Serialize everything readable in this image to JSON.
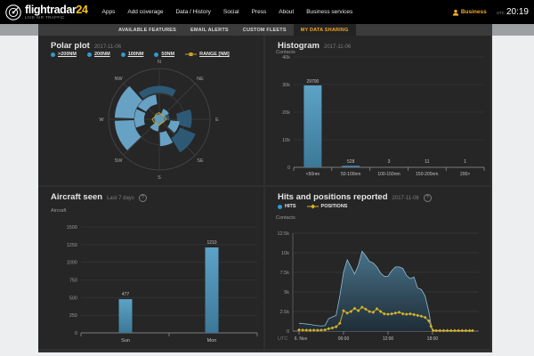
{
  "header": {
    "logo": {
      "name": "flightradar",
      "accent": "24",
      "tagline": "LIVE AIR TRAFFIC"
    },
    "nav": [
      "Apps",
      "Add coverage",
      "Data / History",
      "Social",
      "Press",
      "About",
      "Business services"
    ],
    "account_label": "Business",
    "utc_label": "UTC",
    "clock": "20:19"
  },
  "subnav": {
    "items": [
      {
        "label": "AVAILABLE FEATURES",
        "active": false
      },
      {
        "label": "EMAIL ALERTS",
        "active": false
      },
      {
        "label": "CUSTOM FLEETS",
        "active": false
      },
      {
        "label": "MY DATA SHARING",
        "active": true
      }
    ]
  },
  "chart_data": {
    "polar": {
      "type": "polar",
      "title": "Polar plot",
      "date": "2017-11-06",
      "legend": [
        ">200NM",
        "200NM",
        "100NM",
        "50NM"
      ],
      "range_series": "RANGE [NM]",
      "compass": [
        "N",
        "NE",
        "E",
        "SE",
        "S",
        "SW",
        "W",
        "NW"
      ],
      "colors": {
        "light": "#6cacd1",
        "dark": "#2f5d7c",
        "range": "#c9a227",
        "dot": "#2f9ad0"
      },
      "sectors": [
        {
          "from": -38,
          "to": 30,
          "inner": 0.52,
          "outer": 0.66,
          "shade": "dark"
        },
        {
          "from": 300,
          "to": 352,
          "inner": 0.3,
          "outer": 0.49,
          "shade": "light"
        },
        {
          "from": 250,
          "to": 294,
          "inner": 0.3,
          "outer": 0.49,
          "shade": "light"
        },
        {
          "from": 272,
          "to": 318,
          "inner": 0.5,
          "outer": 0.88,
          "shade": "light"
        },
        {
          "from": 226,
          "to": 268,
          "inner": 0.5,
          "outer": 0.88,
          "shade": "light"
        },
        {
          "from": 72,
          "to": 106,
          "inner": 0.35,
          "outer": 0.64,
          "shade": "dark"
        },
        {
          "from": 112,
          "to": 148,
          "inner": 0.44,
          "outer": 0.77,
          "shade": "dark"
        },
        {
          "from": 150,
          "to": 178,
          "inner": 0.26,
          "outer": 0.53,
          "shade": "light"
        },
        {
          "from": 96,
          "to": 132,
          "inner": 0.22,
          "outer": 0.4,
          "shade": "light"
        },
        {
          "from": 20,
          "to": 60,
          "inner": 0.1,
          "outer": 0.22,
          "shade": "light"
        },
        {
          "from": 185,
          "to": 230,
          "inner": 0.1,
          "outer": 0.24,
          "shade": "light"
        },
        {
          "from": 58,
          "to": 96,
          "inner": 0.1,
          "outer": 0.2,
          "shade": "dark"
        }
      ],
      "center_blob_r": 0.1,
      "range_polygon": [
        [
          0,
          0.13
        ],
        [
          30,
          0.1
        ],
        [
          60,
          0.11
        ],
        [
          90,
          0.14
        ],
        [
          120,
          0.1
        ],
        [
          150,
          0.09
        ],
        [
          180,
          0.12
        ],
        [
          210,
          0.1
        ],
        [
          240,
          0.12
        ],
        [
          270,
          0.14
        ],
        [
          300,
          0.1
        ],
        [
          330,
          0.12
        ]
      ]
    },
    "histogram": {
      "type": "bar",
      "title": "Histogram",
      "date": "2017-11-06",
      "ylabel": "Contacts",
      "categories": [
        "<50nm",
        "50-100nm",
        "100-150nm",
        "150-200nm",
        "200>"
      ],
      "values": [
        29700,
        528,
        3,
        11,
        1
      ],
      "yticks": [
        "0",
        "10k",
        "20k",
        "30k",
        "40k"
      ],
      "ymax": 40000,
      "bar_color_top": "#5da3c6",
      "bar_color_bottom": "#3c7898"
    },
    "aircraft_seen": {
      "type": "bar",
      "title": "Aircraft seen",
      "subtitle": "Last 7 days",
      "ylabel": "Aircraft",
      "categories": [
        "Sun",
        "Mon"
      ],
      "values": [
        477,
        1210
      ],
      "yticks": [
        "0",
        "250",
        "500",
        "750",
        "1000",
        "1250",
        "1500"
      ],
      "ymax": 1500,
      "bar_color_top": "#5da3c6",
      "bar_color_bottom": "#3c7898"
    },
    "hits_positions": {
      "type": "area",
      "title": "Hits and positions reported",
      "date": "2017-11-06",
      "ylabel": "Contacts",
      "utc_label": "UTC",
      "yticks": [
        "0",
        "2.5k",
        "5k",
        "7.5k",
        "10k",
        "12.5k"
      ],
      "ymax": 12500,
      "xticks": [
        {
          "label": "6. Nov",
          "hour": 0
        },
        {
          "label": "06:00",
          "hour": 6
        },
        {
          "label": "12:00",
          "hour": 12
        },
        {
          "label": "18:00",
          "hour": 18
        }
      ],
      "series": [
        {
          "name": "HITS",
          "kind": "area",
          "stroke": "#8fbdd4",
          "fill_top": "#4a768e",
          "fill_bottom": "#1f2d38",
          "points": [
            [
              0,
              1000
            ],
            [
              0.5,
              950
            ],
            [
              1,
              900
            ],
            [
              1.5,
              850
            ],
            [
              2,
              750
            ],
            [
              2.5,
              700
            ],
            [
              3,
              650
            ],
            [
              3.5,
              700
            ],
            [
              4,
              1600
            ],
            [
              4.5,
              1800
            ],
            [
              5,
              2000
            ],
            [
              5.5,
              4500
            ],
            [
              6,
              7500
            ],
            [
              6.5,
              9100
            ],
            [
              7,
              8200
            ],
            [
              7.5,
              7300
            ],
            [
              8,
              8400
            ],
            [
              8.5,
              10200
            ],
            [
              9,
              9600
            ],
            [
              9.5,
              8900
            ],
            [
              10,
              8700
            ],
            [
              10.5,
              8200
            ],
            [
              11,
              7400
            ],
            [
              11.5,
              7000
            ],
            [
              12,
              7000
            ],
            [
              12.5,
              7700
            ],
            [
              13,
              8200
            ],
            [
              13.5,
              8200
            ],
            [
              14,
              8000
            ],
            [
              14.5,
              7100
            ],
            [
              15,
              6700
            ],
            [
              15.5,
              6900
            ],
            [
              16,
              5500
            ],
            [
              16.5,
              5300
            ],
            [
              17,
              4500
            ],
            [
              17.5,
              2500
            ],
            [
              17.9,
              300
            ],
            [
              18.1,
              0
            ],
            [
              23.4,
              0
            ]
          ]
        },
        {
          "name": "POSITIONS",
          "kind": "line",
          "stroke": "#d9b427",
          "points": [
            [
              0,
              150
            ],
            [
              0.5,
              120
            ],
            [
              1,
              120
            ],
            [
              1.5,
              100
            ],
            [
              2,
              120
            ],
            [
              2.5,
              100
            ],
            [
              3,
              120
            ],
            [
              3.5,
              150
            ],
            [
              4,
              300
            ],
            [
              4.5,
              400
            ],
            [
              5,
              550
            ],
            [
              5.5,
              1000
            ],
            [
              6,
              2600
            ],
            [
              6.5,
              2300
            ],
            [
              7,
              2500
            ],
            [
              7.5,
              2900
            ],
            [
              8,
              2600
            ],
            [
              8.5,
              3050
            ],
            [
              9,
              2800
            ],
            [
              9.5,
              2500
            ],
            [
              10,
              2400
            ],
            [
              10.5,
              2850
            ],
            [
              11,
              2500
            ],
            [
              11.5,
              2200
            ],
            [
              12,
              2150
            ],
            [
              12.5,
              2200
            ],
            [
              13,
              2300
            ],
            [
              13.5,
              2400
            ],
            [
              14,
              2200
            ],
            [
              14.5,
              2150
            ],
            [
              15,
              2200
            ],
            [
              15.5,
              2100
            ],
            [
              16,
              2000
            ],
            [
              16.5,
              1900
            ],
            [
              17,
              1750
            ],
            [
              17.5,
              1300
            ],
            [
              17.8,
              600
            ],
            [
              18.1,
              80
            ],
            [
              18.5,
              60
            ],
            [
              19,
              60
            ],
            [
              19.5,
              60
            ],
            [
              20,
              60
            ],
            [
              20.5,
              60
            ],
            [
              21,
              60
            ],
            [
              21.5,
              60
            ],
            [
              22,
              60
            ],
            [
              22.5,
              60
            ],
            [
              23,
              60
            ],
            [
              23.4,
              60
            ]
          ]
        }
      ]
    }
  }
}
